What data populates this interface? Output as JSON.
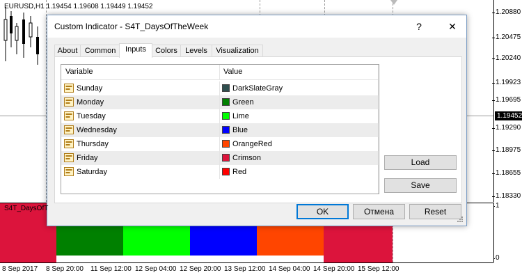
{
  "chart": {
    "symbol_info": "EURUSD,H1  1.19454 1.19608 1.19449 1.19452",
    "price_ticks": [
      "1.20880",
      "1.20475",
      "1.20240",
      "1.19923",
      "1.19695",
      "1.19452",
      "1.19290",
      "1.18975",
      "1.18655",
      "1.18330"
    ],
    "current_price": "1.19452",
    "subwindow_label": "S4T_DaysOfT",
    "subwindow_scale_top": "1",
    "subwindow_scale_bottom": "0",
    "time_labels": [
      "8 Sep 2017",
      "8 Sep 20:00",
      "11 Sep 12:00",
      "12 Sep 04:00",
      "12 Sep 20:00",
      "13 Sep 12:00",
      "14 Sep 04:00",
      "14 Sep 20:00",
      "15 Sep 12:00"
    ],
    "bands": [
      "#dc143c",
      "#008000",
      "#00ff00",
      "#0000ff",
      "#ff4500",
      "#dc143c",
      "#ffffff"
    ]
  },
  "dialog": {
    "title": "Custom Indicator - S4T_DaysOfTheWeek",
    "help": "?",
    "close": "✕",
    "tabs": [
      "About",
      "Common",
      "Inputs",
      "Colors",
      "Levels",
      "Visualization"
    ],
    "active_tab": "Inputs",
    "columns": [
      "Variable",
      "Value"
    ],
    "rows": [
      {
        "variable": "Sunday",
        "value": "DarkSlateGray",
        "color": "#2f4f4f"
      },
      {
        "variable": "Monday",
        "value": "Green",
        "color": "#008000"
      },
      {
        "variable": "Tuesday",
        "value": "Lime",
        "color": "#00ff00"
      },
      {
        "variable": "Wednesday",
        "value": "Blue",
        "color": "#0000ff"
      },
      {
        "variable": "Thursday",
        "value": "OrangeRed",
        "color": "#ff4500"
      },
      {
        "variable": "Friday",
        "value": "Crimson",
        "color": "#dc143c"
      },
      {
        "variable": "Saturday",
        "value": "Red",
        "color": "#ff0000"
      }
    ],
    "load_label": "Load",
    "save_label": "Save",
    "ok_label": "OK",
    "cancel_label": "Отмена",
    "reset_label": "Reset"
  }
}
